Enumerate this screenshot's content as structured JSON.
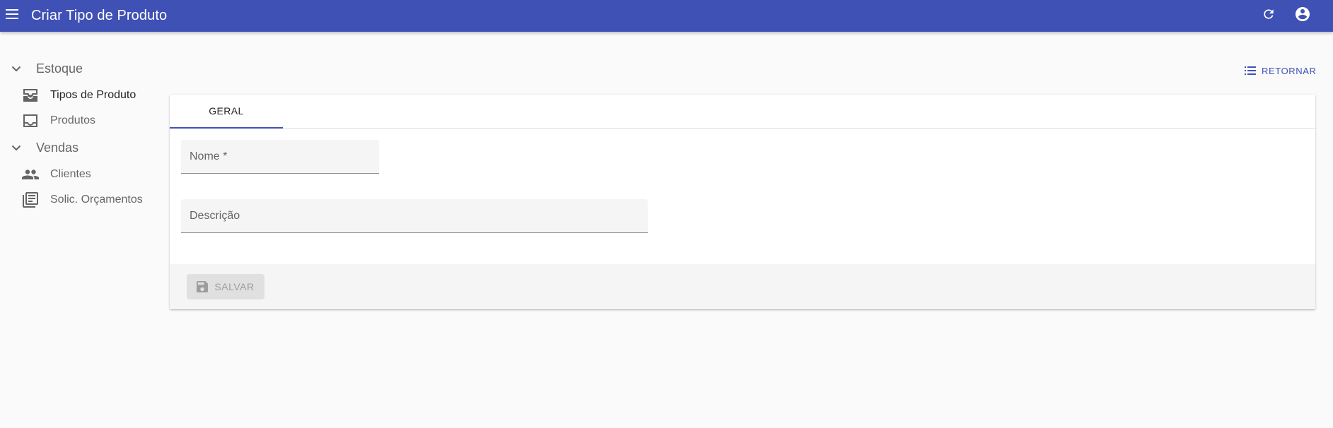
{
  "appbar": {
    "title": "Criar Tipo de Produto",
    "menu_icon": "menu-icon",
    "refresh_icon": "refresh-icon",
    "account_icon": "account-circle-icon",
    "color": "#3f51b5"
  },
  "sidebar": {
    "groups": [
      {
        "label": "Estoque",
        "icon": "chevron-down-icon",
        "items": [
          {
            "label": "Tipos de Produto",
            "icon": "inbox-tray-icon",
            "active": true
          },
          {
            "label": "Produtos",
            "icon": "inbox-icon",
            "active": false
          }
        ]
      },
      {
        "label": "Vendas",
        "icon": "chevron-down-icon",
        "items": [
          {
            "label": "Clientes",
            "icon": "people-icon",
            "active": false
          },
          {
            "label": "Solic. Orçamentos",
            "icon": "library-books-icon",
            "active": false
          }
        ]
      }
    ]
  },
  "actions": {
    "return_label": "RETORNAR",
    "return_icon": "list-icon"
  },
  "form": {
    "tabs": [
      {
        "label": "GERAL",
        "active": true
      }
    ],
    "fields": {
      "nome": {
        "placeholder": "Nome *",
        "value": ""
      },
      "descricao": {
        "placeholder": "Descrição",
        "value": ""
      }
    },
    "save_label": "SALVAR",
    "save_icon": "save-icon",
    "save_disabled": true
  }
}
